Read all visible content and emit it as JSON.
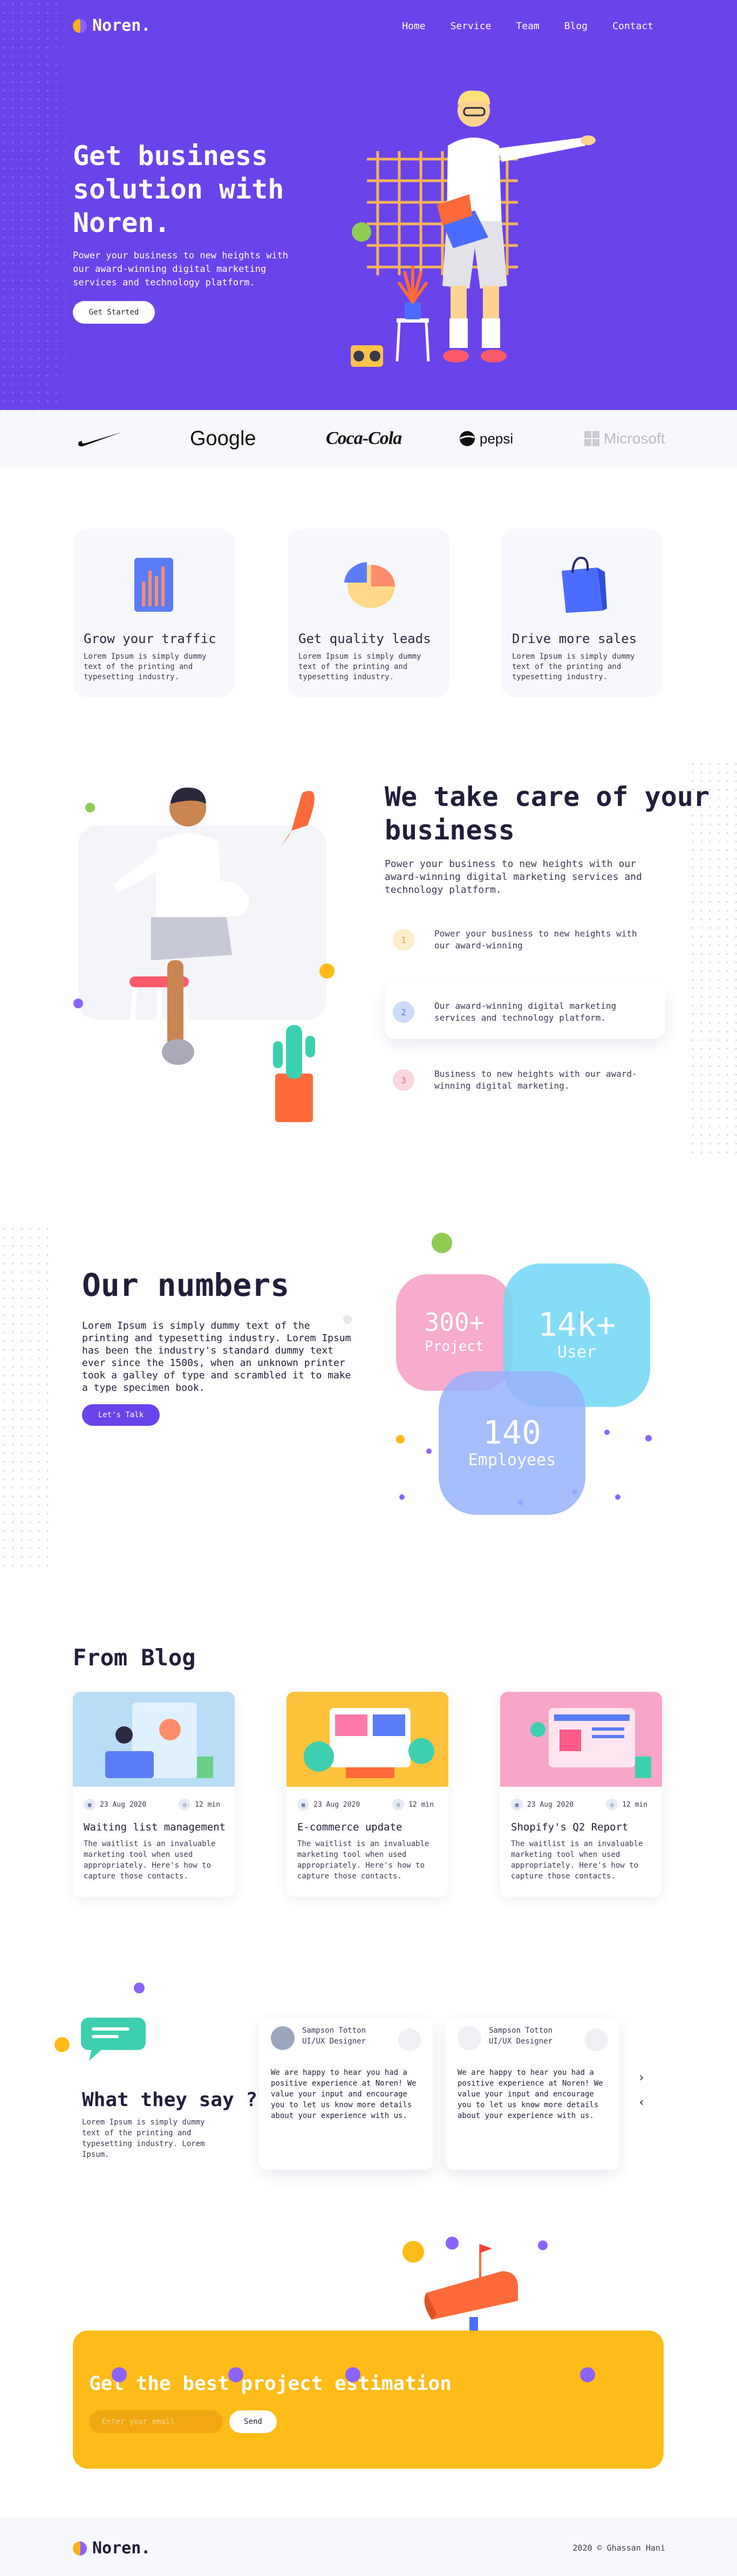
{
  "brand": {
    "name": "Noren."
  },
  "nav": [
    {
      "label": "Home"
    },
    {
      "label": "Service"
    },
    {
      "label": "Team"
    },
    {
      "label": "Blog"
    },
    {
      "label": "Contact"
    }
  ],
  "hero": {
    "title": "Get business solution with Noren.",
    "subtitle": "Power your business to new heights with our award-winning digital marketing services and technology platform.",
    "cta_label": "Get Started"
  },
  "partners": [
    {
      "name": "nike",
      "icon": "nike-swoosh-icon"
    },
    {
      "name": "Google"
    },
    {
      "name": "Coca-Cola"
    },
    {
      "name": "pepsi",
      "icon": "pepsi-globe-icon"
    },
    {
      "name": "Microsoft",
      "icon": "windows-logo-icon"
    }
  ],
  "features": [
    {
      "title": "Grow your traffic",
      "text": "Lorem Ipsum is simply dummy text of the printing and typesetting industry.",
      "icon": "bar-chart-icon"
    },
    {
      "title": "Get quality leads",
      "text": "Lorem Ipsum is simply dummy text of the printing and typesetting industry.",
      "icon": "pie-chart-icon"
    },
    {
      "title": "Drive more sales",
      "text": "Lorem Ipsum is simply dummy text of the printing and typesetting industry.",
      "icon": "shopping-bag-icon"
    }
  ],
  "care": {
    "title": "We take care of your business",
    "subtitle": "Power your business to new heights with our award-winning digital marketing services and technology platform.",
    "items": [
      {
        "num": "1",
        "text": "Power your business to new heights with our award-winning"
      },
      {
        "num": "2",
        "text": "Our award-winning digital marketing services and technology platform."
      },
      {
        "num": "3",
        "text": "Business to new heights with our award-winning digital marketing."
      }
    ]
  },
  "numbers": {
    "title": "Our numbers",
    "text": "Lorem Ipsum is simply dummy text of the printing and typesetting industry. Lorem Ipsum has been the industry's standard dummy text ever since the 1500s, when an unknown printer took a galley of type and scrambled it to make a type specimen book.",
    "cta_label": "Let's Talk",
    "stats": [
      {
        "value": "300+",
        "label": "Project"
      },
      {
        "value": "14k+",
        "label": "User"
      },
      {
        "value": "140",
        "label": "Employees"
      }
    ]
  },
  "blog": {
    "heading": "From Blog",
    "posts": [
      {
        "date": "23 Aug 2020",
        "read": "12 min",
        "title": "Waiting list management",
        "excerpt": "The waitlist is an invaluable marketing tool when used appropriately. Here's how to capture those contacts."
      },
      {
        "date": "23 Aug 2020",
        "read": "12 min",
        "title": "E-commerce update",
        "excerpt": "The waitlist is an invaluable marketing tool when used appropriately. Here's how to capture those contacts."
      },
      {
        "date": "23 Aug 2020",
        "read": "12 min",
        "title": "Shopify's Q2 Report",
        "excerpt": "The waitlist is an invaluable marketing tool when used appropriately. Here's how to capture those contacts."
      }
    ]
  },
  "testimonials": {
    "title": "What they say ?",
    "text": "Lorem Ipsum is simply dummy text of the printing and typesetting industry. Lorem Ipsum.",
    "items": [
      {
        "name": "Sampson Totton",
        "role": "UI/UX Designer",
        "text": "We are happy to hear you had a positive experience at Noren! We value your input and encourage you to let us know more details about your experience with us."
      },
      {
        "name": "Sampson Totton",
        "role": "UI/UX Designer",
        "text": "We are happy to hear you had a positive experience at Noren! We value your input and encourage you to let us know more details about your experience with us."
      }
    ],
    "next_icon": "chevron-right-icon",
    "prev_icon": "chevron-left-icon"
  },
  "cta": {
    "title": "Get the best project estimation",
    "email_placeholder": "Enter your email",
    "send_label": "Send"
  },
  "footer": {
    "copyright": "2020 © Ghassan Hani"
  },
  "colors": {
    "primary": "#6a44ea",
    "accent": "#ffbb17",
    "pink": "#f7a5c9",
    "cyan": "#7ddcf2",
    "blue": "#a9c2fb"
  }
}
